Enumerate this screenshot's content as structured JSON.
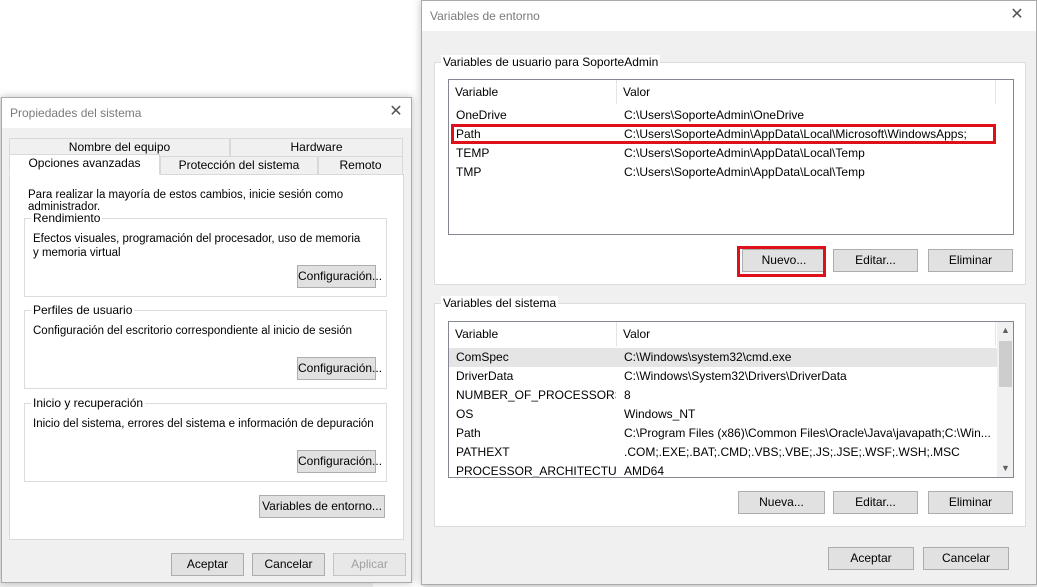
{
  "sysprops": {
    "title": "Propiedades del sistema",
    "tabs_top": [
      "Nombre del equipo",
      "Hardware"
    ],
    "tabs_bottom": [
      "Opciones avanzadas",
      "Protección del sistema",
      "Remoto"
    ],
    "admin_note": "Para realizar la mayoría de estos cambios, inicie sesión como administrador.",
    "groups": [
      {
        "label": "Rendimiento",
        "text": "Efectos visuales, programación del procesador, uso de memoria y memoria virtual",
        "button": "Configuración..."
      },
      {
        "label": "Perfiles de usuario",
        "text": "Configuración del escritorio correspondiente al inicio de sesión",
        "button": "Configuración..."
      },
      {
        "label": "Inicio y recuperación",
        "text": "Inicio del sistema, errores del sistema e información de depuración",
        "button": "Configuración..."
      }
    ],
    "env_button": "Variables de entorno...",
    "buttons": {
      "ok": "Aceptar",
      "cancel": "Cancelar",
      "apply": "Aplicar"
    }
  },
  "envvars": {
    "title": "Variables de entorno",
    "user_group": "Variables de usuario para SoporteAdmin",
    "columns": {
      "variable": "Variable",
      "value": "Valor"
    },
    "user_rows": [
      {
        "name": "OneDrive",
        "value": "C:\\Users\\SoporteAdmin\\OneDrive"
      },
      {
        "name": "Path",
        "value": "C:\\Users\\SoporteAdmin\\AppData\\Local\\Microsoft\\WindowsApps;"
      },
      {
        "name": "TEMP",
        "value": "C:\\Users\\SoporteAdmin\\AppData\\Local\\Temp"
      },
      {
        "name": "TMP",
        "value": "C:\\Users\\SoporteAdmin\\AppData\\Local\\Temp"
      }
    ],
    "user_buttons": {
      "new": "Nuevo...",
      "edit": "Editar...",
      "delete": "Eliminar"
    },
    "system_group": "Variables del sistema",
    "system_rows": [
      {
        "name": "ComSpec",
        "value": "C:\\Windows\\system32\\cmd.exe"
      },
      {
        "name": "DriverData",
        "value": "C:\\Windows\\System32\\Drivers\\DriverData"
      },
      {
        "name": "NUMBER_OF_PROCESSORS",
        "value": "8"
      },
      {
        "name": "OS",
        "value": "Windows_NT"
      },
      {
        "name": "Path",
        "value": "C:\\Program Files (x86)\\Common Files\\Oracle\\Java\\javapath;C:\\Win..."
      },
      {
        "name": "PATHEXT",
        "value": ".COM;.EXE;.BAT;.CMD;.VBS;.VBE;.JS;.JSE;.WSF;.WSH;.MSC"
      },
      {
        "name": "PROCESSOR_ARCHITECTURE",
        "value": "AMD64"
      }
    ],
    "system_buttons": {
      "new": "Nueva...",
      "edit": "Editar...",
      "delete": "Eliminar"
    },
    "buttons": {
      "ok": "Aceptar",
      "cancel": "Cancelar"
    }
  },
  "colors": {
    "highlight_box": "#e0101a",
    "focus_border": "#0078d7"
  }
}
